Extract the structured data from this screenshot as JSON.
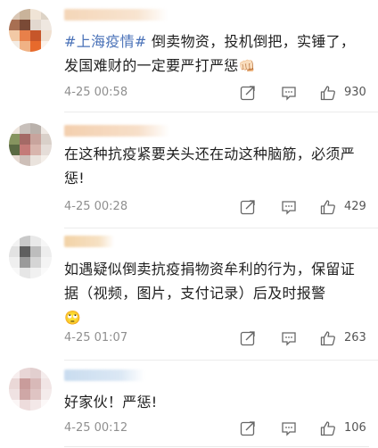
{
  "comments": [
    {
      "topic": "#上海疫情#",
      "text": " 倒卖物资，投机倒把，实锤了，发国难财的一定要严打严惩",
      "emoji": "👊🏻",
      "time": "4-25 00:58",
      "likes": "930",
      "colors": {
        "avatar": [
          "#d9c6b4",
          "#c9b39a",
          "#f0e4d6",
          "#ddd3c6",
          "#a86f52",
          "#7a4a36",
          "#e2d8cf",
          "#efe7e0",
          "#f2c9a5",
          "#e8804a",
          "#c6562a",
          "#f0e0d0",
          "#f4ede5",
          "#f0b285",
          "#e76a2c",
          "#fbf3ec"
        ],
        "name": "#f4d6b8"
      }
    },
    {
      "text": "在这种抗疫紧要关头还在动这种脑筋，必须严惩!",
      "time": "4-25 00:28",
      "likes": "429",
      "colors": {
        "avatar": [
          "#ede4dc",
          "#c8c0bb",
          "#b9b1ab",
          "#efe9e4",
          "#86945f",
          "#a46a66",
          "#c8a49d",
          "#d9d0c9",
          "#5a6a43",
          "#c47b78",
          "#d8b5ad",
          "#e5ddd8",
          "#e6dad2",
          "#cdbfb8",
          "#eae3dd",
          "#f4efea"
        ],
        "name": "#f3cfae"
      }
    },
    {
      "text": "如遇疑似倒卖抗疫捐物资牟利的行为，保留证据（视频，图片，支付记录）后及时报警",
      "emoji": "🙄",
      "time": "4-25 01:07",
      "likes": "263",
      "colors": {
        "avatar": [
          "#f2f2f2",
          "#c9c9c9",
          "#e9e9e9",
          "#f6f6f6",
          "#e2e2e2",
          "#5f5f5f",
          "#bdbdbd",
          "#ededed",
          "#efefef",
          "#9a9a9a",
          "#d5d5d5",
          "#f4f4f4",
          "#f8f8f8",
          "#e6e6e6",
          "#f1f1f1",
          "#fafafa"
        ],
        "name": "#f2d2a6"
      }
    },
    {
      "text": "好家伙！严惩!",
      "time": "4-25 00:12",
      "likes": "106",
      "colors": {
        "avatar": [
          "#f7eeee",
          "#e8d6d6",
          "#e2cfcf",
          "#f5eded",
          "#ead8d7",
          "#c99c9b",
          "#d8b9b8",
          "#f1e5e5",
          "#efe2e2",
          "#cfa7a6",
          "#dfc4c3",
          "#f4ebeb",
          "#fbf6f6",
          "#eddcdc",
          "#f3e8e8",
          "#fcf8f8"
        ],
        "name": "#c9dcef"
      }
    }
  ]
}
